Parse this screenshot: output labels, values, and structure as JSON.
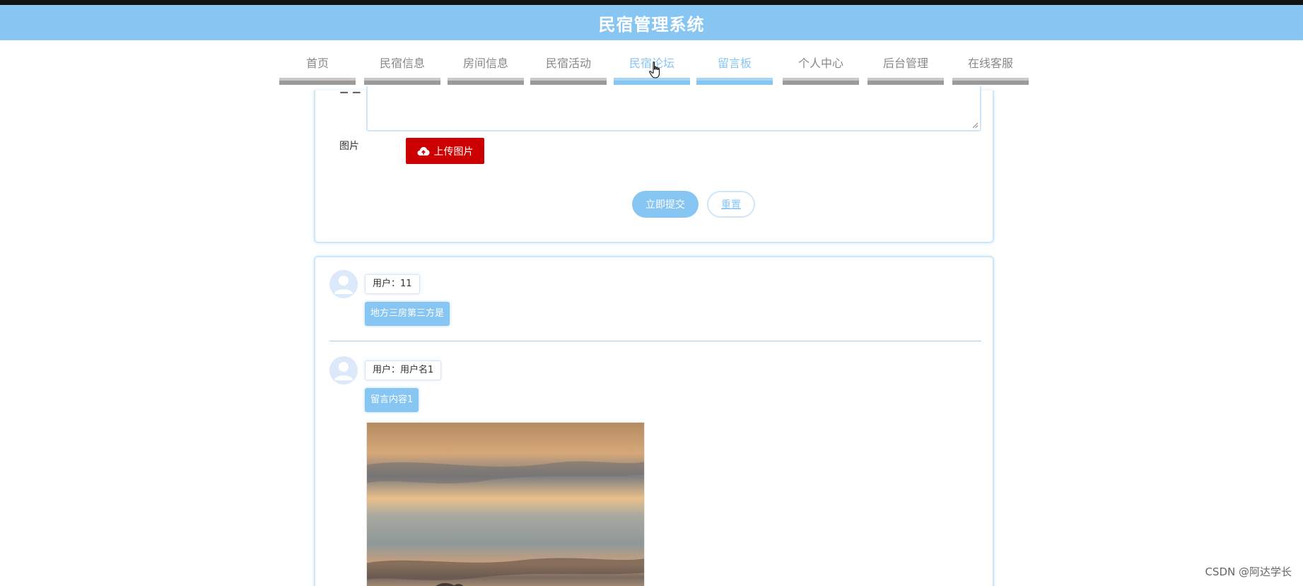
{
  "header": {
    "title": "民宿管理系统"
  },
  "nav": {
    "items": [
      {
        "label": "首页"
      },
      {
        "label": "民宿信息"
      },
      {
        "label": "房间信息"
      },
      {
        "label": "民宿活动"
      },
      {
        "label": "民宿论坛"
      },
      {
        "label": "留言板"
      },
      {
        "label": "个人中心"
      },
      {
        "label": "后台管理"
      },
      {
        "label": "在线客服"
      }
    ],
    "active_item": "留言板",
    "hover_item": "民宿论坛"
  },
  "form": {
    "image_label": "图片",
    "upload_label": "上传图片",
    "submit_label": "立即提交",
    "reset_label": "重置"
  },
  "messages": [
    {
      "user": "用户：11",
      "content": "地方三房第三方是"
    },
    {
      "user": "用户：用户名1",
      "content": "留言内容1"
    }
  ],
  "watermark": "CSDN @阿达学长",
  "colors": {
    "accent": "#87c5f2",
    "upload_button": "#cc0000",
    "nav_bar_inactive": "#9a9a9a"
  },
  "icons": {
    "upload": "cloud-upload-icon",
    "avatar": "user-avatar-icon",
    "cursor": "hand-pointer-icon"
  }
}
